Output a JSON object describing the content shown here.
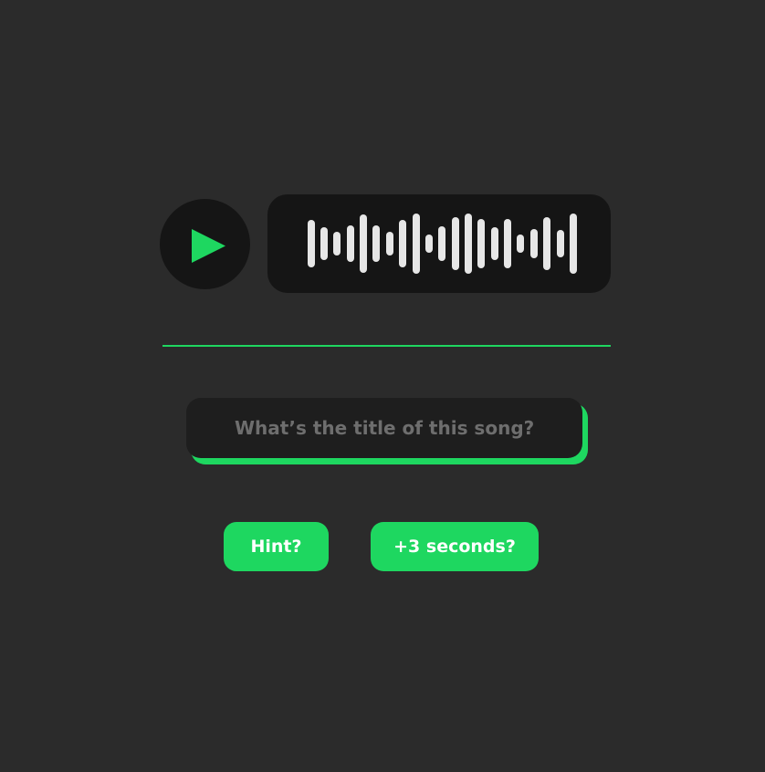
{
  "player": {
    "play_icon": "play-icon",
    "waveform_icon": "waveform-icon",
    "accent_color": "#1ed760"
  },
  "guess": {
    "placeholder": "What’s the title of this song?",
    "value": ""
  },
  "actions": {
    "hint_label": "Hint?",
    "extra_time_label": "+3 seconds?"
  },
  "colors": {
    "background": "#2b2b2b",
    "panel": "#151515",
    "input_background": "#1e1e1e",
    "accent": "#1ed760",
    "waveform_bars": "#e6e6e6",
    "placeholder": "#6e6e6e"
  }
}
